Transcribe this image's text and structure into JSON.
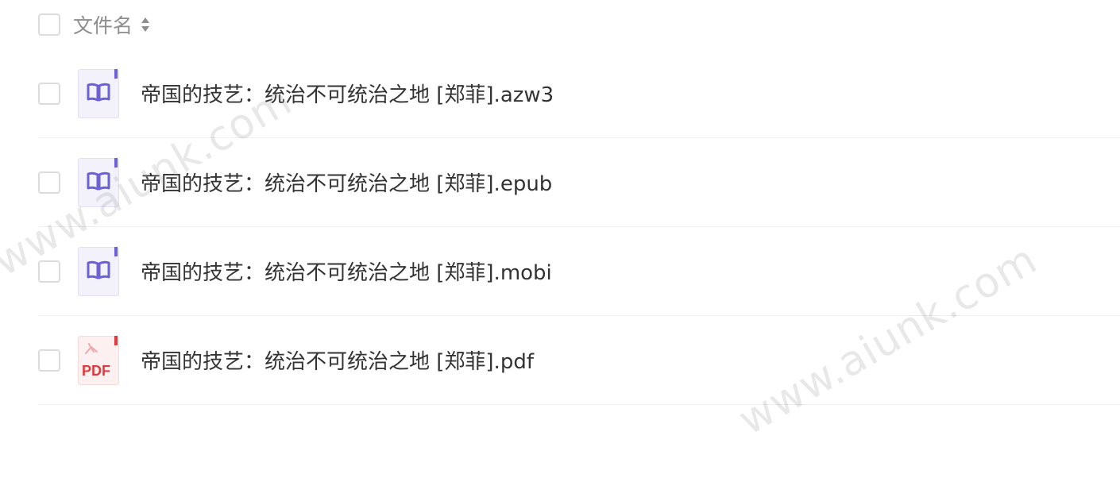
{
  "list": {
    "header": {
      "name_label": "文件名"
    },
    "files": [
      {
        "name": "帝国的技艺：统治不可统治之地 [郑菲].azw3",
        "icon": "ebook-icon"
      },
      {
        "name": "帝国的技艺：统治不可统治之地 [郑菲].epub",
        "icon": "ebook-icon"
      },
      {
        "name": "帝国的技艺：统治不可统治之地 [郑菲].mobi",
        "icon": "ebook-icon"
      },
      {
        "name": "帝国的技艺：统治不可统治之地 [郑菲].pdf",
        "icon": "pdf-icon",
        "icon_text": "PDF"
      }
    ]
  },
  "watermark": {
    "text": "www.aiunk.com"
  },
  "colors": {
    "ebook_icon_bg": "#f3f2fb",
    "ebook_icon_accent": "#6b60d6",
    "pdf_icon_bg": "#fdf0f0",
    "pdf_icon_accent": "#e0393e"
  }
}
